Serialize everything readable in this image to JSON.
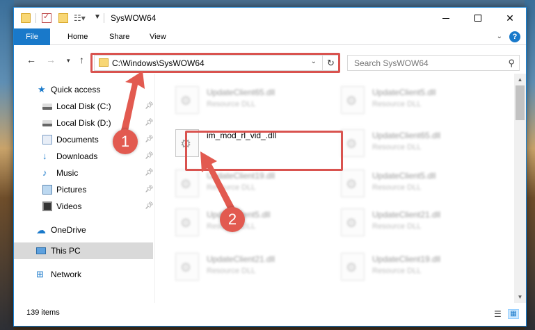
{
  "window": {
    "title": "SysWOW64"
  },
  "ribbon": {
    "tabs": [
      "File",
      "Home",
      "Share",
      "View"
    ]
  },
  "address_bar": {
    "path": "C:\\Windows\\SysWOW64"
  },
  "search": {
    "placeholder": "Search SysWOW64"
  },
  "sidebar": {
    "items": [
      {
        "label": "Quick access",
        "icon": "star-icon",
        "pinned": false
      },
      {
        "label": "Local Disk (C:)",
        "icon": "disk-icon",
        "pinned": true
      },
      {
        "label": "Local Disk (D:)",
        "icon": "disk-icon",
        "pinned": true
      },
      {
        "label": "Documents",
        "icon": "documents-icon",
        "pinned": true
      },
      {
        "label": "Downloads",
        "icon": "download-icon",
        "pinned": true
      },
      {
        "label": "Music",
        "icon": "music-icon",
        "pinned": true
      },
      {
        "label": "Pictures",
        "icon": "pictures-icon",
        "pinned": true
      },
      {
        "label": "Videos",
        "icon": "videos-icon",
        "pinned": true
      },
      {
        "label": "OneDrive",
        "icon": "cloud-icon",
        "pinned": false
      },
      {
        "label": "This PC",
        "icon": "pc-icon",
        "pinned": false,
        "selected": true
      },
      {
        "label": "Network",
        "icon": "network-icon",
        "pinned": false
      }
    ]
  },
  "files": {
    "items": [
      {
        "name": "UpdateClient65.dll",
        "type": "Resource DLL"
      },
      {
        "name": "UpdateClient5.dll",
        "type": "Resource DLL"
      },
      {
        "name": "im_mod_rl_vid_.dll",
        "type": ""
      },
      {
        "name": "UpdateClient65.dll",
        "type": "Resource DLL"
      },
      {
        "name": "UpdateClient19.dll",
        "type": "Resource DLL"
      },
      {
        "name": "UpdateClient5.dll",
        "type": "Resource DLL"
      },
      {
        "name": "UpdateClient5.dll",
        "type": "Resource DLL"
      },
      {
        "name": "UpdateClient21.dll",
        "type": "Resource DLL"
      },
      {
        "name": "UpdateClient21.dll",
        "type": "Resource DLL"
      },
      {
        "name": "UpdateClient19.dll",
        "type": "Resource DLL"
      }
    ]
  },
  "status": {
    "item_count": "139 items"
  },
  "callouts": {
    "step1": "1",
    "step2": "2"
  },
  "colors": {
    "accent": "#1979ca",
    "highlight": "#d9534f",
    "callout": "#e25a50"
  }
}
